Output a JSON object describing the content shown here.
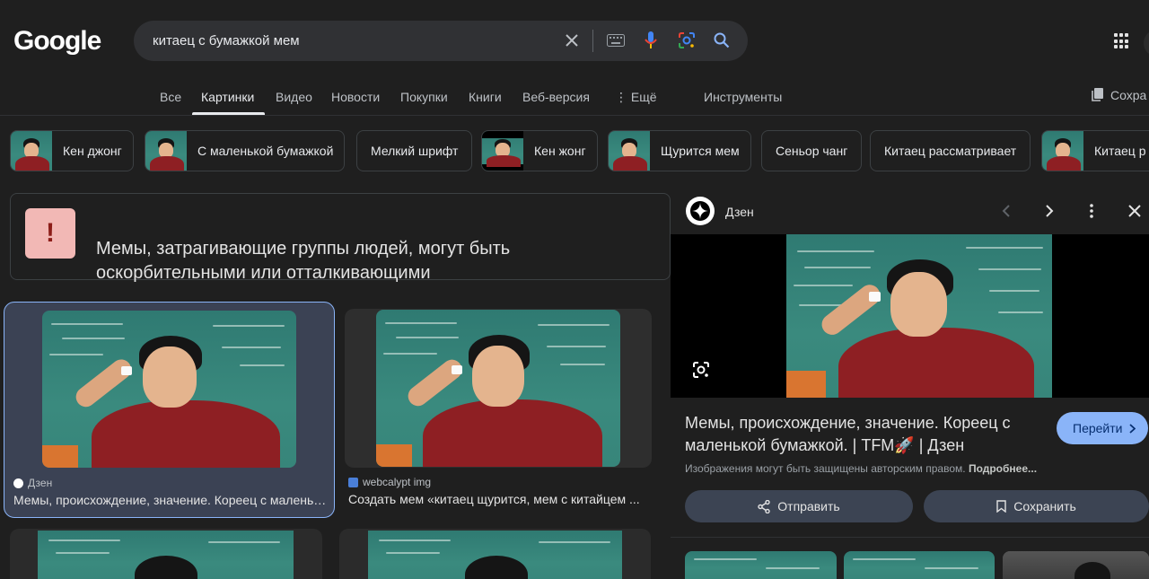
{
  "logo": "Google",
  "search": {
    "query": "китаец с бумажкой мем"
  },
  "tabs": [
    {
      "label": "Все"
    },
    {
      "label": "Картинки"
    },
    {
      "label": "Видео"
    },
    {
      "label": "Новости"
    },
    {
      "label": "Покупки"
    },
    {
      "label": "Книги"
    },
    {
      "label": "Веб-версия"
    },
    {
      "label": "⋮ Ещё"
    },
    {
      "label": "Инструменты"
    }
  ],
  "saved_label": "Сохра",
  "chips": [
    {
      "label": "Кен джонг"
    },
    {
      "label": "С маленькой бумажкой"
    },
    {
      "label": "Мелкий шрифт"
    },
    {
      "label": "Кен жонг"
    },
    {
      "label": "Щурится мем"
    },
    {
      "label": "Сеньор чанг"
    },
    {
      "label": "Китаец рассматривает"
    },
    {
      "label": "Китаец р"
    }
  ],
  "warning": {
    "icon": "!",
    "text": "Мемы, затрагивающие группы людей, могут быть оскорбительными или отталкивающими"
  },
  "results": [
    {
      "source": "Дзен",
      "title": "Мемы, происхождение, значение. Кореец с маленькой бумажкой. | TFM | Дзен"
    },
    {
      "source": "webcalypt img",
      "title": "Создать мем «китаец щурится, мем с китайцем ..."
    }
  ],
  "panel": {
    "source": "Дзен",
    "title": "Мемы, происхождение, значение. Кореец с маленькой бумажкой. | TFM🚀 | Дзен",
    "visit_label": "Перейти",
    "copyright_text": "Изображения могут быть защищены авторским правом.",
    "copyright_more": "Подробнее...",
    "share_label": "Отправить",
    "save_label": "Сохранить"
  },
  "colors": {
    "accent": "#8ab4f8",
    "background": "#1f1f1f",
    "warning_badge": "#f2b8b5"
  }
}
